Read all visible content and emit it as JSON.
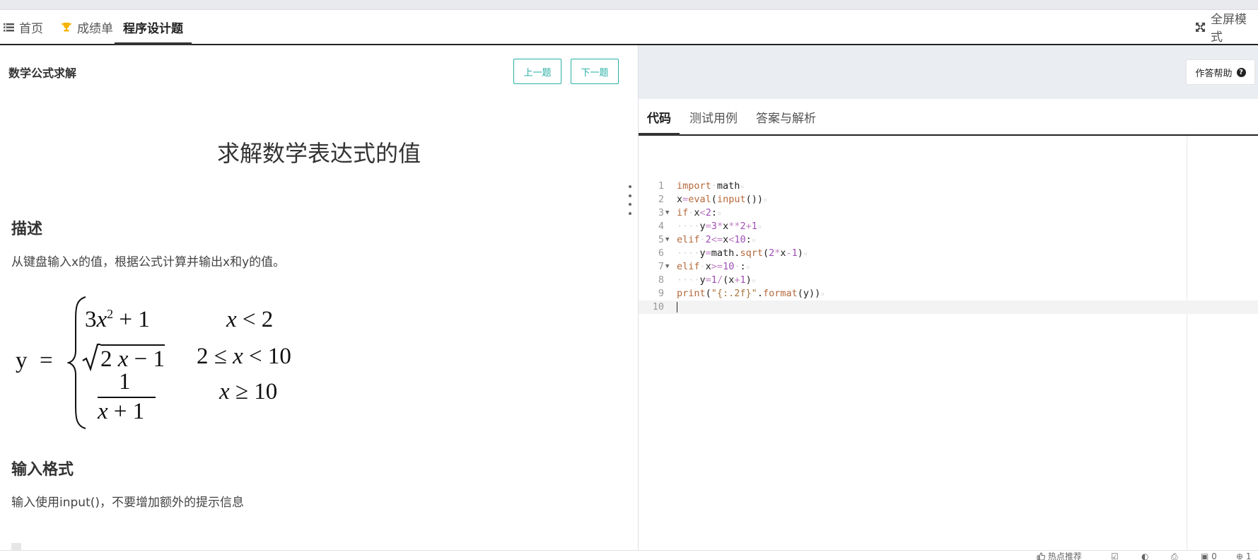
{
  "nav": {
    "items": [
      {
        "label": "首页",
        "icon": "home-list-icon"
      },
      {
        "label": "成绩单",
        "icon": "trophy-icon",
        "icon_color": "#f5b400"
      },
      {
        "label": "程序设计题",
        "active": true
      }
    ],
    "fullscreen_label": "全屏模式"
  },
  "question": {
    "title": "数学公式求解",
    "prev_label": "上一题",
    "next_label": "下一题",
    "problem_title": "求解数学表达式的值",
    "description_heading": "描述",
    "description_text": "从键盘输入x的值，根据公式计算并输出x和y的值。",
    "formula": {
      "lhs": "y",
      "eq": "=",
      "rows": [
        {
          "expr": "3x² + 1",
          "cond": "x < 2"
        },
        {
          "expr": "√(2x − 1)",
          "cond": "2 ≤ x < 10"
        },
        {
          "expr": "1 / (x + 1)",
          "cond": "x ≥ 10"
        }
      ]
    },
    "input_heading": "输入格式",
    "input_text": "输入使用input()，不要增加额外的提示信息"
  },
  "editor": {
    "help_label": "作答帮助",
    "tabs": [
      {
        "label": "代码",
        "active": true
      },
      {
        "label": "测试用例"
      },
      {
        "label": "答案与解析"
      }
    ],
    "lines": [
      "import math",
      "x=eval(input())",
      "if x<2:",
      "    y=3*x**2+1",
      "elif 2<=x<10:",
      "    y=math.sqrt(2*x-1)",
      "elif x>=10 :",
      "    y=1/(x+1)",
      "print(\"{:.2f}\".format(y))",
      ""
    ],
    "line_numbers": [
      "1",
      "2",
      "3",
      "4",
      "5",
      "6",
      "7",
      "8",
      "9",
      "10"
    ],
    "current_line": 10
  },
  "statusbar": {
    "hot_label": "热点推荐",
    "count_a": "0",
    "count_b": "1"
  },
  "colors": {
    "accent": "#2bb0a5",
    "trophy": "#f5b400",
    "panel_bg": "#eaedf1"
  }
}
